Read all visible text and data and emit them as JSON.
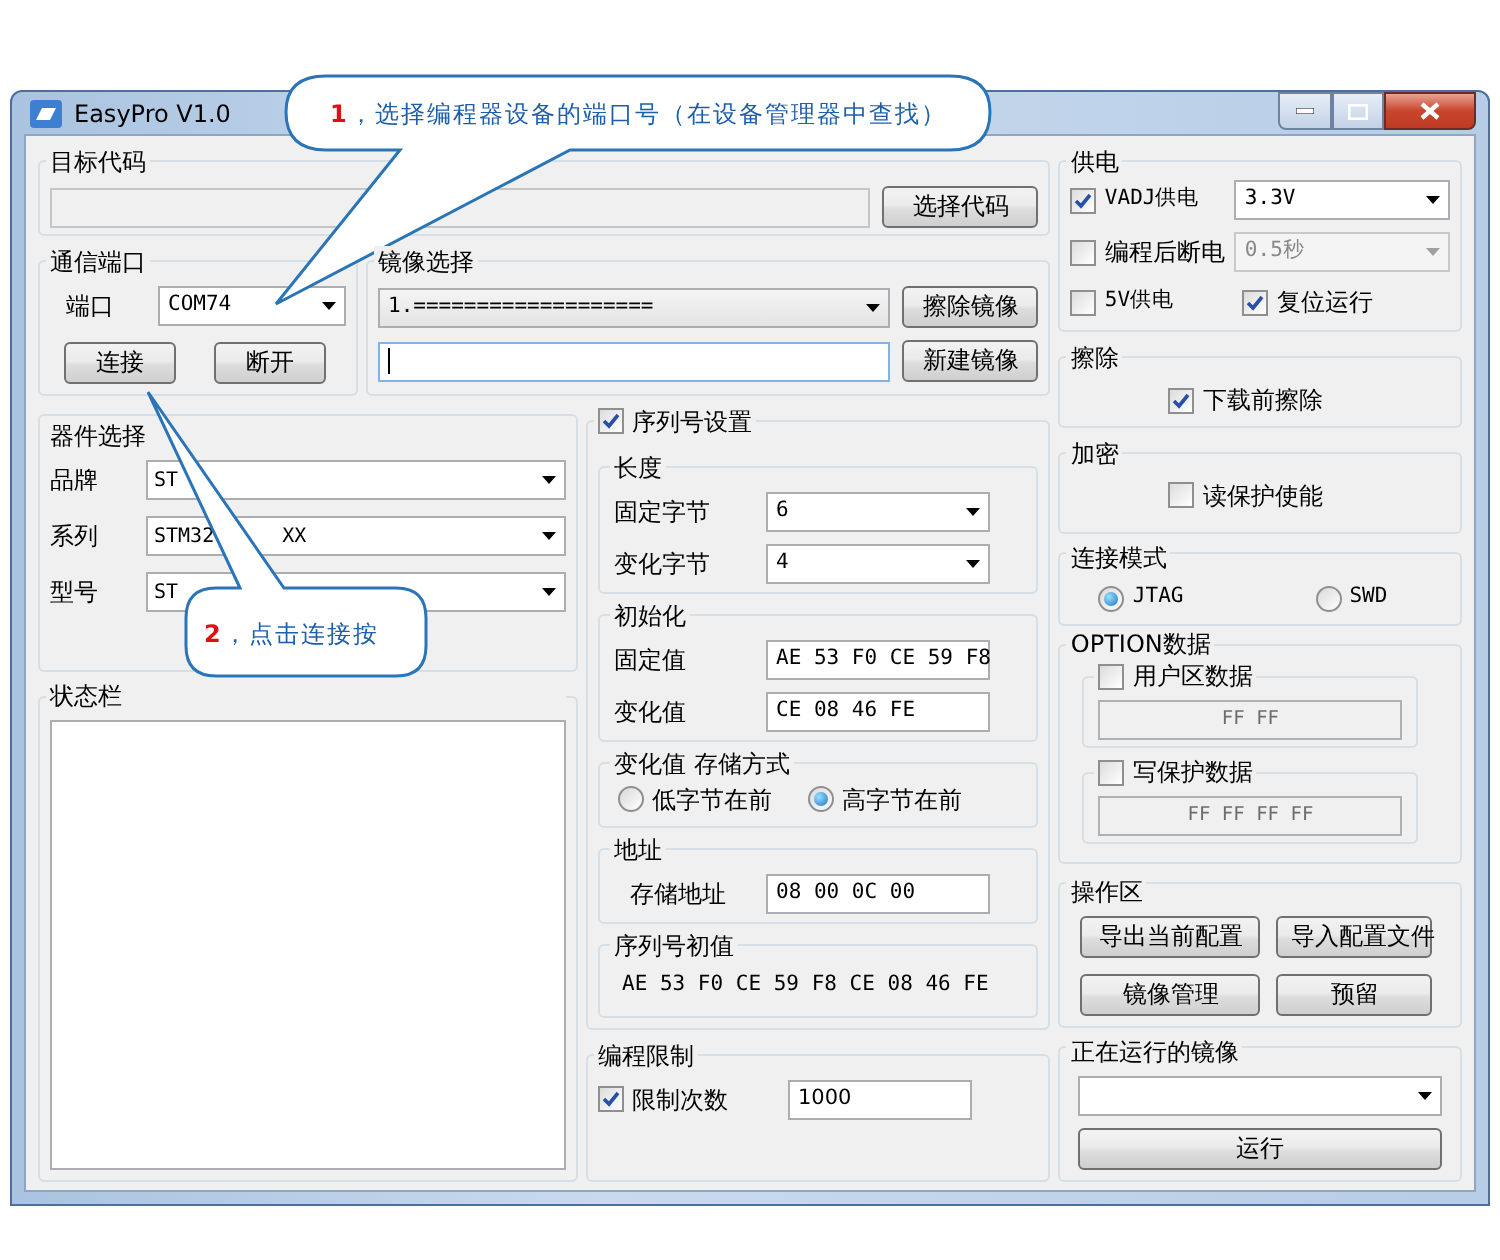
{
  "window": {
    "title": "EasyPro V1.0"
  },
  "target_code": {
    "title": "目标代码",
    "button": "选择代码"
  },
  "comm_port": {
    "title": "通信端口",
    "label": "端口",
    "value": "COM74",
    "buttons": [
      "连接",
      "断开"
    ]
  },
  "image_select": {
    "title": "镜像选择",
    "value": "1.===================",
    "buttons": [
      "擦除镜像",
      "新建镜像"
    ]
  },
  "device_select": {
    "title": "器件选择",
    "rows": [
      {
        "label": "品牌",
        "value": "ST"
      },
      {
        "label": "系列",
        "value": "STM32",
        "value_tail": "XX"
      },
      {
        "label": "型号",
        "value": "ST"
      }
    ]
  },
  "status_bar": {
    "title": "状态栏"
  },
  "serial": {
    "title": "序列号设置",
    "checked": true,
    "length": {
      "title": "长度",
      "rows": [
        {
          "label": "固定字节",
          "value": "6"
        },
        {
          "label": "变化字节",
          "value": "4"
        }
      ]
    },
    "init": {
      "title": "初始化",
      "rows": [
        {
          "label": "固定值",
          "value": "AE 53 F0 CE 59 F8"
        },
        {
          "label": "变化值",
          "value": "CE 08 46 FE"
        }
      ]
    },
    "storage": {
      "title": "变化值 存储方式",
      "options": [
        {
          "label": "低字节在前",
          "selected": false
        },
        {
          "label": "高字节在前",
          "selected": true
        }
      ]
    },
    "address": {
      "title": "地址",
      "label": "存储地址",
      "value": "08 00 0C 00"
    },
    "initial": {
      "title": "序列号初值",
      "value": "AE 53 F0 CE 59 F8 CE 08 46 FE"
    }
  },
  "prog_limit": {
    "title": "编程限制",
    "label": "限制次数",
    "checked": true,
    "value": "1000"
  },
  "power": {
    "title": "供电",
    "items": [
      {
        "label": "VADJ供电",
        "checked": true,
        "value": "3.3V",
        "disabled": false
      },
      {
        "label": "编程后断电",
        "checked": false,
        "value": "0.5秒",
        "disabled": true
      }
    ],
    "checks": [
      {
        "label": "5V供电",
        "checked": false
      },
      {
        "label": "复位运行",
        "checked": true
      }
    ]
  },
  "erase": {
    "title": "擦除",
    "label": "下载前擦除",
    "checked": true
  },
  "encrypt": {
    "title": "加密",
    "label": "读保护使能",
    "checked": false
  },
  "connect_mode": {
    "title": "连接模式",
    "options": [
      {
        "label": "JTAG",
        "selected": true
      },
      {
        "label": "SWD",
        "selected": false
      }
    ]
  },
  "option_data": {
    "title": "OPTION数据",
    "items": [
      {
        "label": "用户区数据",
        "checked": false,
        "value": "FF FF"
      },
      {
        "label": "写保护数据",
        "checked": false,
        "value": "FF FF FF FF"
      }
    ]
  },
  "operations": {
    "title": "操作区",
    "buttons": [
      "导出当前配置",
      "导入配置文件",
      "镜像管理",
      "预留"
    ]
  },
  "running_image": {
    "title": "正在运行的镜像",
    "button": "运行"
  },
  "callouts": [
    {
      "number": "1",
      "text": "，选择编程器设备的端口号（在设备管理器中查找）"
    },
    {
      "number": "2",
      "text": "，点击连接按"
    }
  ]
}
